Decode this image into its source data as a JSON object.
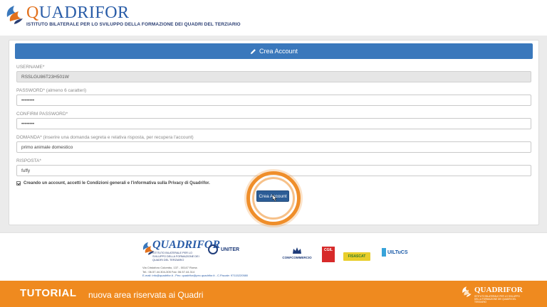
{
  "header": {
    "logo_text": "QUADRIFOR",
    "logo_subtitle": "ISTITUTO BILATERALE PER LO SVILUPPO DELLA FORMAZIONE DEI QUADRI DEL TERZIARIO"
  },
  "form": {
    "title": "Crea Account",
    "fields": [
      {
        "label": "USERNAME*",
        "value": "RSSLGU86T23H501W",
        "readonly": true
      },
      {
        "label": "PASSWORD* (almeno 6 caratteri)",
        "value": "••••••••"
      },
      {
        "label": "CONFIRM PASSWORD*",
        "value": "••••••••"
      },
      {
        "label": "DOMANDA* (inserire una domanda segreta e relativa risposta, per recupera l'account)",
        "value": "primo animale domestico"
      },
      {
        "label": "RISPOSTA*",
        "value": "fuffy"
      }
    ],
    "agree_text": "Creando un account, accetti le Condizioni generali e l'informativa sulla Privacy di Quadrifor.",
    "agree_checked": true,
    "submit_label": "Crea Account"
  },
  "footer": {
    "logo_text": "QUADRIFOR",
    "logo_subtitle": "ISTITUTO BILATERALE PER LO SVILUPPO DELLA FORMAZIONE DEI QUADRI DEL TERZIARIO",
    "partners": {
      "uniter": "UNITER",
      "confcommercio": "CONFCOMMERCIO",
      "cgil": "CGIL",
      "filcams": "FISASCAT",
      "uiltucs": "UILTuCS"
    },
    "address_lines": [
      "Via Cristoforo Colombo, 137 - 00147 Roma",
      "Tel.: 06.57.44.304-305 Fax: 06.57.44.314",
      "E-mail: info@quadrifor.it - Pec: quadrifor@pec.quadrifor.it - C.Fiscale: 97115220580"
    ]
  },
  "tutorial": {
    "title": "TUTORIAL",
    "subtitle": "nuova area riservata ai Quadri",
    "logo_text": "QUADRIFOR",
    "logo_subtitle": "ISTITUTO BILATERALE PER LO SVILUPPO DELLA FORMAZIONE DEI QUADRI DEL TERZIARIO"
  },
  "colors": {
    "primary_blue": "#3a78bc",
    "button_blue": "#2c5d96",
    "accent_orange": "#ef8a1f"
  },
  "icons": [
    "quadrifor-logo-icon",
    "pencil-icon",
    "checkbox-icon",
    "cursor-icon"
  ]
}
